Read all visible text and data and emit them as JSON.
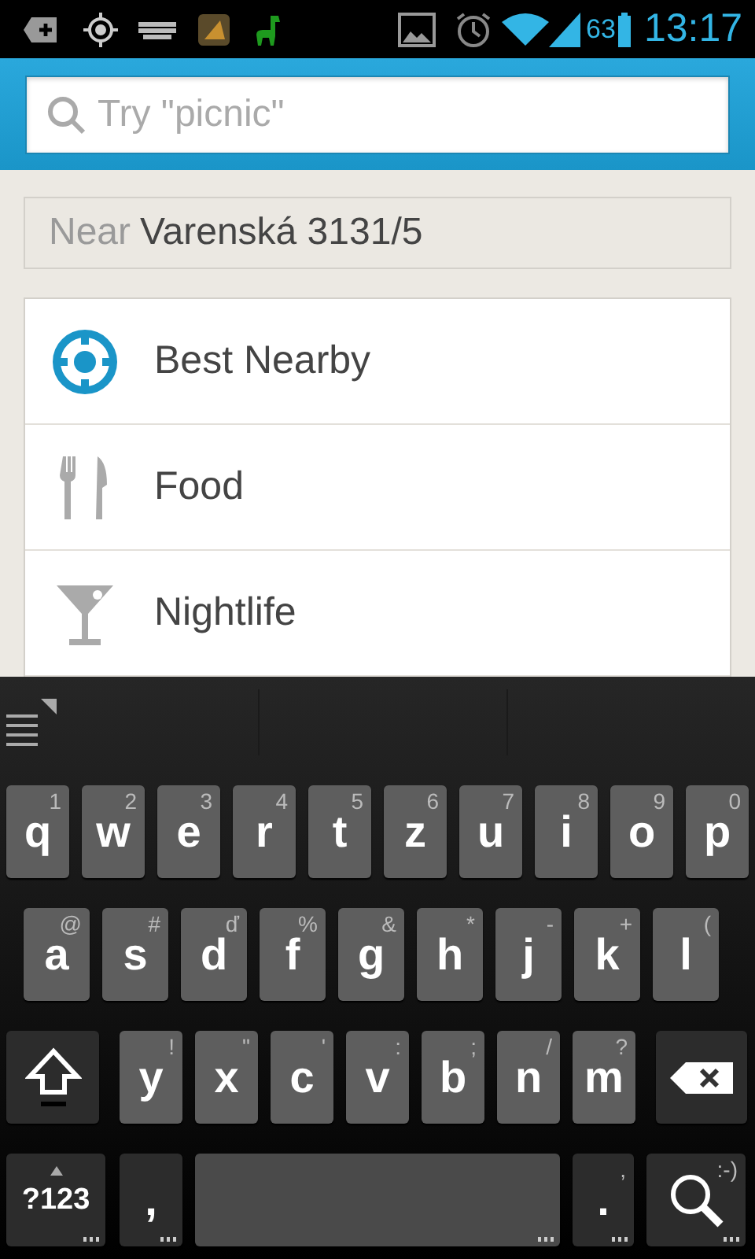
{
  "status_bar": {
    "battery": "63",
    "time": "13:17"
  },
  "search": {
    "placeholder": "Try \"picnic\""
  },
  "location": {
    "prefix": "Near",
    "value": "Varenská 3131/5"
  },
  "categories": [
    {
      "label": "Best Nearby",
      "kind": "target"
    },
    {
      "label": "Food",
      "kind": "food"
    },
    {
      "label": "Nightlife",
      "kind": "nightlife"
    }
  ],
  "keyboard": {
    "rows": [
      {
        "keys": [
          {
            "kind": "letter",
            "label": "q",
            "hint": "1"
          },
          {
            "kind": "letter",
            "label": "w",
            "hint": "2"
          },
          {
            "kind": "letter",
            "label": "e",
            "hint": "3"
          },
          {
            "kind": "letter",
            "label": "r",
            "hint": "4"
          },
          {
            "kind": "letter",
            "label": "t",
            "hint": "5"
          },
          {
            "kind": "letter",
            "label": "z",
            "hint": "6"
          },
          {
            "kind": "letter",
            "label": "u",
            "hint": "7"
          },
          {
            "kind": "letter",
            "label": "i",
            "hint": "8"
          },
          {
            "kind": "letter",
            "label": "o",
            "hint": "9"
          },
          {
            "kind": "letter",
            "label": "p",
            "hint": "0"
          }
        ]
      },
      {
        "keys": [
          {
            "kind": "letter",
            "label": "a",
            "hint": "@"
          },
          {
            "kind": "letter",
            "label": "s",
            "hint": "#"
          },
          {
            "kind": "letter",
            "label": "d",
            "hint": "ď"
          },
          {
            "kind": "letter",
            "label": "f",
            "hint": "%"
          },
          {
            "kind": "letter",
            "label": "g",
            "hint": "&"
          },
          {
            "kind": "letter",
            "label": "h",
            "hint": "*"
          },
          {
            "kind": "letter",
            "label": "j",
            "hint": "-"
          },
          {
            "kind": "letter",
            "label": "k",
            "hint": "+"
          },
          {
            "kind": "letter",
            "label": "l",
            "hint": "("
          }
        ]
      },
      {
        "keys": [
          {
            "kind": "shift"
          },
          {
            "kind": "letter",
            "label": "y",
            "hint": "!"
          },
          {
            "kind": "letter",
            "label": "x",
            "hint": "\""
          },
          {
            "kind": "letter",
            "label": "c",
            "hint": "'"
          },
          {
            "kind": "letter",
            "label": "v",
            "hint": ":"
          },
          {
            "kind": "letter",
            "label": "b",
            "hint": ";"
          },
          {
            "kind": "letter",
            "label": "n",
            "hint": "/"
          },
          {
            "kind": "letter",
            "label": "m",
            "hint": "?"
          },
          {
            "kind": "delete"
          }
        ]
      },
      {
        "keys": [
          {
            "kind": "mode",
            "label": "?123"
          },
          {
            "kind": "punct",
            "label": ","
          },
          {
            "kind": "space"
          },
          {
            "kind": "punct",
            "label": ".",
            "hint": ","
          },
          {
            "kind": "search",
            "hint": ":-)"
          }
        ]
      }
    ]
  }
}
